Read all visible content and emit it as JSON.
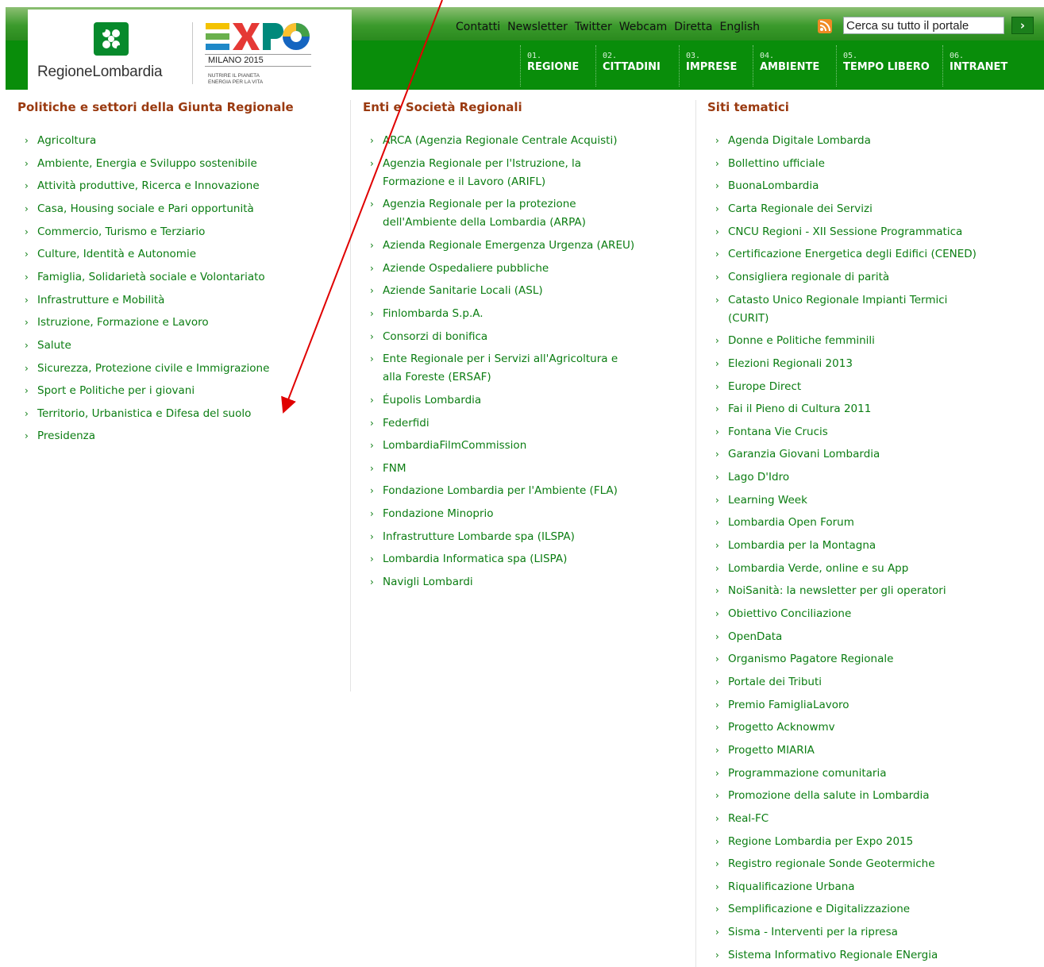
{
  "branding": {
    "region_name": "RegioneLombardia",
    "expo_text": "EXPO",
    "expo_subtitle": "MILANO 2015",
    "expo_tagline_1": "NUTRIRE IL PIANETA",
    "expo_tagline_2": "ENERGIA PER LA VITA"
  },
  "top_links": [
    "Contatti",
    "Newsletter",
    "Twitter",
    "Webcam",
    "Diretta",
    "English"
  ],
  "search": {
    "value": "Cerca su tutto il portale"
  },
  "nav": [
    {
      "num": "01.",
      "label": "REGIONE"
    },
    {
      "num": "02.",
      "label": "CITTADINI"
    },
    {
      "num": "03.",
      "label": "IMPRESE"
    },
    {
      "num": "04.",
      "label": "AMBIENTE"
    },
    {
      "num": "05.",
      "label": "TEMPO LIBERO"
    },
    {
      "num": "06.",
      "label": "INTRANET"
    }
  ],
  "columns": [
    {
      "title": "Politiche e settori della Giunta Regionale",
      "items": [
        "Agricoltura",
        "Ambiente, Energia e Sviluppo sostenibile",
        "Attività produttive, Ricerca e Innovazione",
        "Casa, Housing sociale e Pari opportunità",
        "Commercio, Turismo e Terziario",
        "Culture, Identità e Autonomie",
        "Famiglia, Solidarietà sociale e Volontariato",
        "Infrastrutture e Mobilità",
        "Istruzione, Formazione e Lavoro",
        "Salute",
        "Sicurezza, Protezione civile e Immigrazione",
        "Sport e Politiche per i giovani",
        "Territorio, Urbanistica e Difesa del suolo",
        "Presidenza"
      ]
    },
    {
      "title": "Enti e Società Regionali",
      "items": [
        "ARCA (Agenzia Regionale Centrale Acquisti)",
        "Agenzia Regionale per l'Istruzione, la\nFormazione e il Lavoro (ARIFL)",
        "Agenzia Regionale per la protezione\ndell'Ambiente della Lombardia (ARPA)",
        "Azienda Regionale Emergenza Urgenza (AREU)",
        "Aziende Ospedaliere pubbliche",
        "Aziende Sanitarie Locali (ASL)",
        "Finlombarda S.p.A.",
        "Consorzi di bonifica",
        "Ente Regionale per i Servizi all'Agricoltura e\nalla Foreste (ERSAF)",
        "Éupolis Lombardia",
        "Federfidi",
        "LombardiaFilmCommission",
        "FNM",
        "Fondazione Lombardia per l'Ambiente (FLA)",
        "Fondazione Minoprio",
        "Infrastrutture Lombarde spa (ILSPA)",
        "Lombardia Informatica spa (LISPA)",
        "Navigli Lombardi"
      ]
    },
    {
      "title": "Siti tematici",
      "items": [
        "Agenda Digitale Lombarda",
        "Bollettino ufficiale",
        "BuonaLombardia",
        "Carta Regionale dei Servizi",
        "CNCU Regioni - XII Sessione Programmatica",
        "Certificazione Energetica degli Edifici (CENED)",
        "Consigliera regionale di parità",
        "Catasto Unico Regionale Impianti Termici\n(CURIT)",
        "Donne e Politiche femminili",
        "Elezioni Regionali 2013",
        "Europe Direct",
        "Fai il Pieno di Cultura 2011",
        "Fontana Vie Crucis",
        "Garanzia Giovani Lombardia",
        "Lago D'Idro",
        "Learning Week",
        "Lombardia Open Forum",
        "Lombardia per la Montagna",
        "Lombardia Verde, online e su App",
        "NoiSanità: la newsletter per gli operatori",
        "Obiettivo Conciliazione",
        "OpenData",
        "Organismo Pagatore Regionale",
        "Portale dei Tributi",
        "Premio FamigliaLavoro",
        "Progetto Acknowmv",
        "Progetto MIARIA",
        "Programmazione comunitaria",
        "Promozione della salute in Lombardia",
        "Real-FC",
        "Regione Lombardia per Expo 2015",
        "Registro regionale Sonde Geotermiche",
        "Riqualificazione Urbana",
        "Semplificazione e Digitalizzazione",
        "Sisma - Interventi per la ripresa",
        "Sistema Informativo Regionale ENergia"
      ]
    }
  ],
  "icons": {
    "rss": "rss-icon",
    "search_button": "chevron-right-icon",
    "list_bullet": "chevron-right-icon",
    "annotation": "red-arrow"
  },
  "colors": {
    "header_green": "#098d0a",
    "link_green": "#0b7d12",
    "heading_brown": "#9a3a10",
    "annotation_red": "#e00000"
  }
}
